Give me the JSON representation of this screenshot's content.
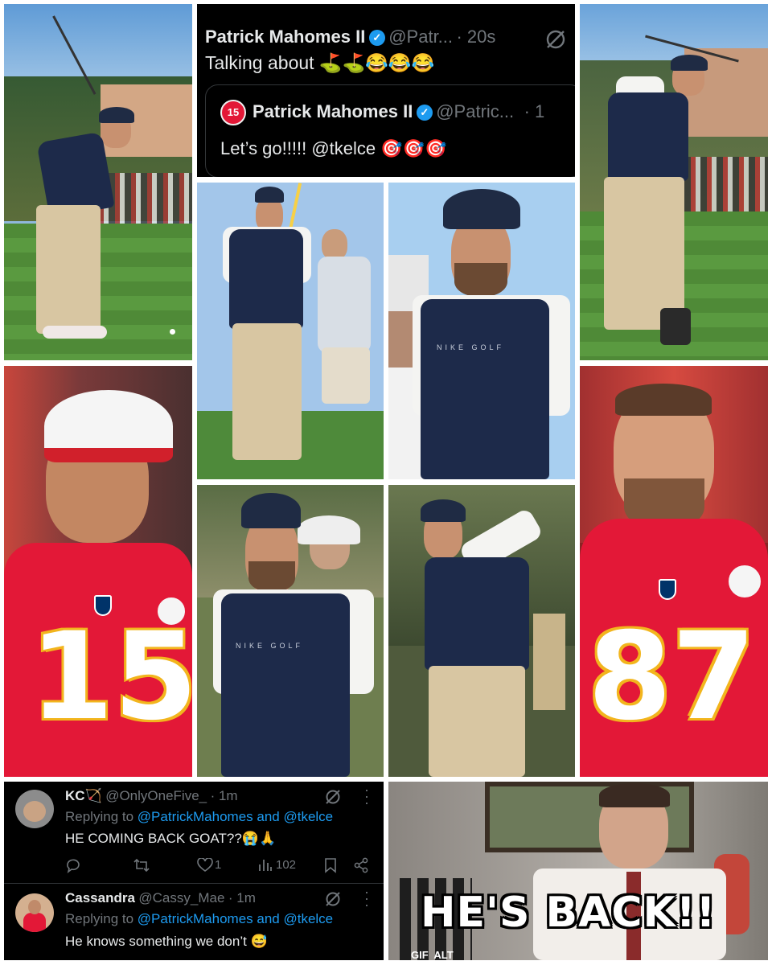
{
  "tweet": {
    "author_name": "Patrick Mahomes II",
    "author_handle": "@Patr...",
    "time": "· 20s",
    "text": "Talking about ⛳⛳😂😂😂",
    "quoted": {
      "author_name": "Patrick Mahomes II",
      "author_handle": "@Patric...",
      "time": "· 1",
      "text": "Let’s go!!!!! @tkelce 🎯🎯🎯"
    }
  },
  "replies": [
    {
      "name": "KC🏹",
      "handle": "@OnlyOneFive_",
      "time": "· 1m",
      "replying_prefix": "Replying to",
      "replying_to": "@PatrickMahomes and @tkelce",
      "text": "HE COMING BACK GOAT??😭🙏",
      "likes": "1",
      "views": "102"
    },
    {
      "name": "Cassandra",
      "handle": "@Cassy_Mae",
      "time": "· 1m",
      "replying_prefix": "Replying to",
      "replying_to": "@PatrickMahomes and @tkelce",
      "text": "He knows something we don’t 😅"
    }
  ],
  "photos": {
    "nike_golf": "NIKE GOLF",
    "mahomes_number": "15",
    "kelce_number": "87"
  },
  "gif": {
    "caption": "HE'S BACK!!",
    "badge": "GIF  ALT"
  },
  "colors": {
    "chiefs_red": "#e31837",
    "chiefs_gold": "#f2b51d",
    "navy_vest": "#1d2a4a",
    "x_blue": "#1d9bf0",
    "x_gray": "#71767b"
  }
}
